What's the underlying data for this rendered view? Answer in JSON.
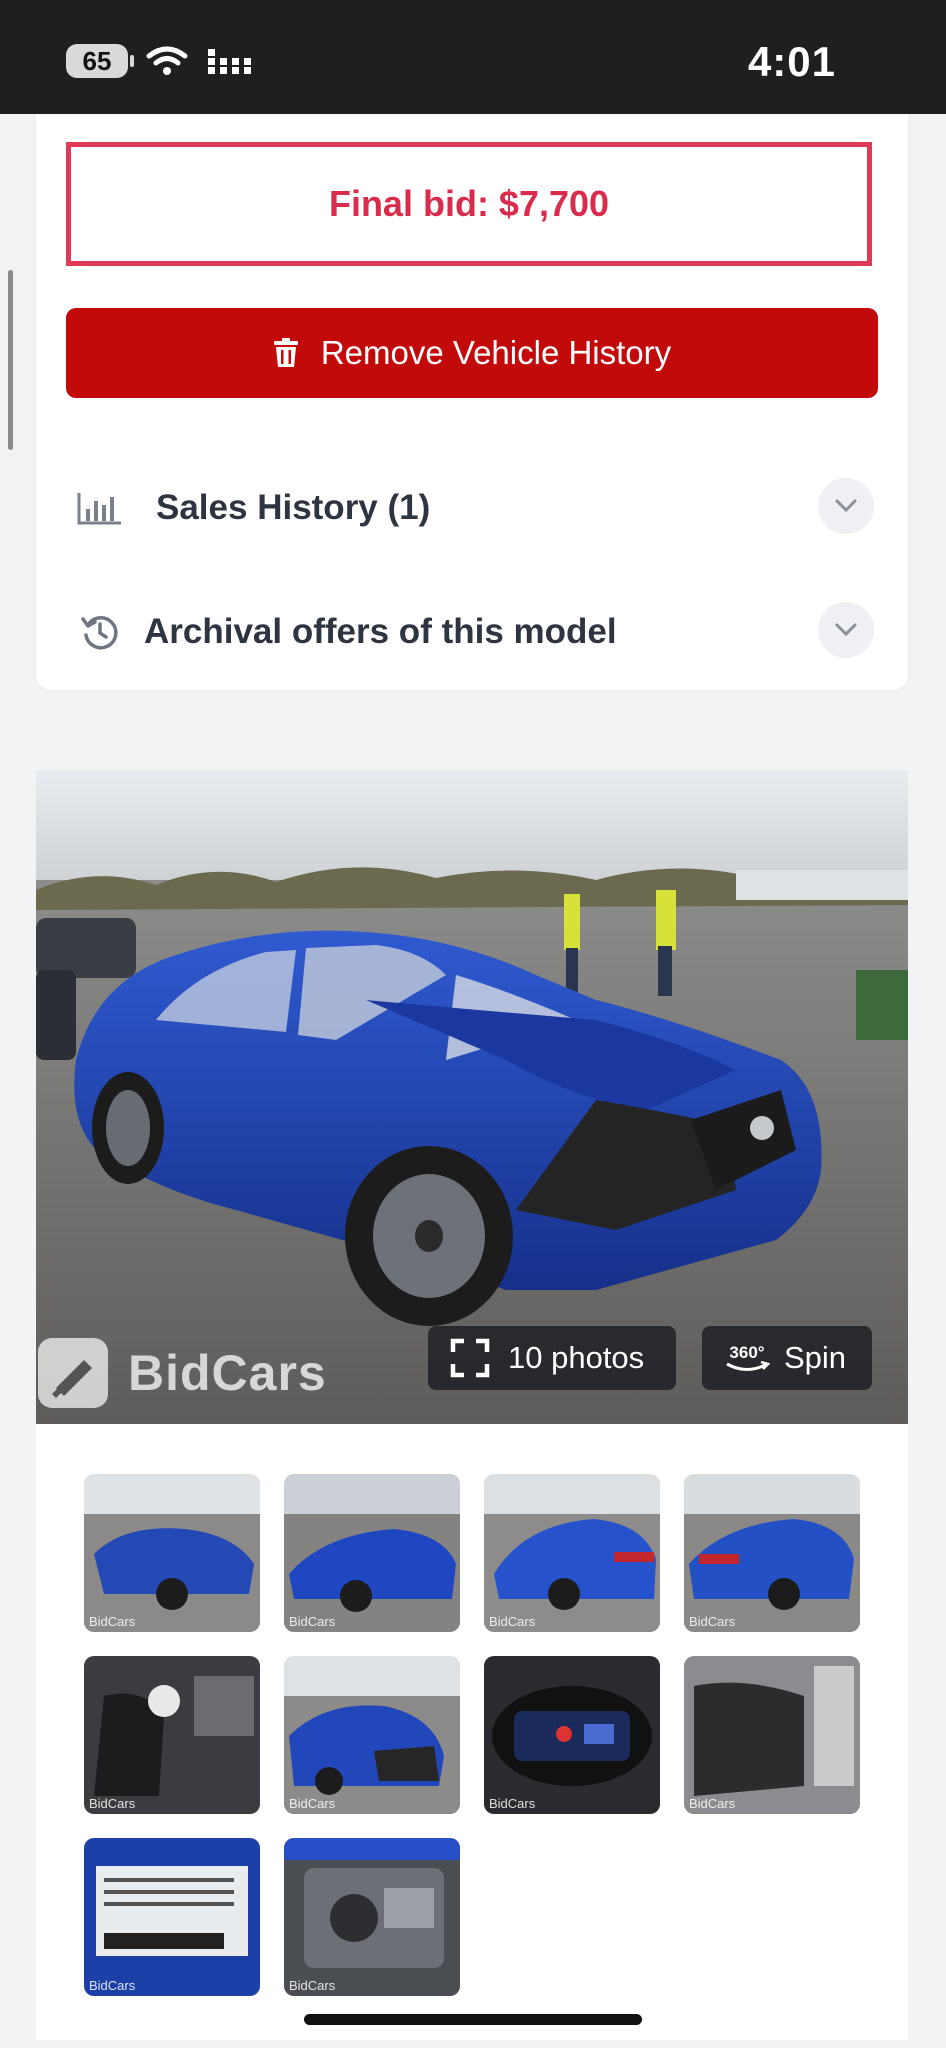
{
  "status_bar": {
    "battery": "65",
    "time": "4:01"
  },
  "final_bid": "Final bid: $7,700",
  "remove_button": "Remove Vehicle History",
  "accordion": [
    {
      "label": "Sales History (1)",
      "icon": "bar-chart-icon"
    },
    {
      "label": "Archival offers of this model",
      "icon": "history-icon"
    }
  ],
  "gallery": {
    "photos_button": "10 photos",
    "spin_badge": "360°",
    "spin_button": "Spin",
    "watermark": "BidCars",
    "thumb_watermark": "BidCars"
  },
  "colors": {
    "final_bid": "#d92b4b",
    "remove_button_bg": "#c30a0a",
    "car_blue": "#1f45b5"
  }
}
